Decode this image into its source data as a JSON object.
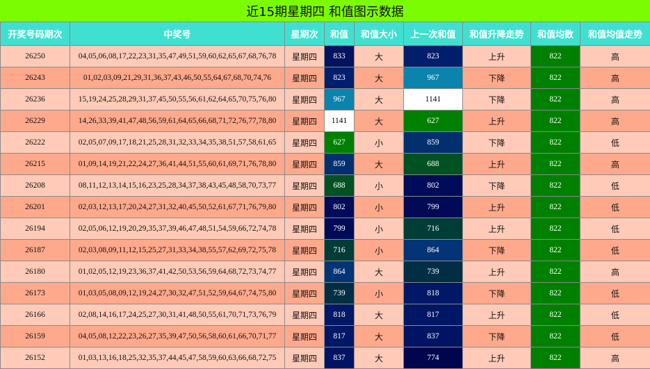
{
  "title": "近15期星期四 和值图示数据",
  "headers": [
    "开奖号码期次",
    "中奖号",
    "星期次",
    "和值",
    "和值大小",
    "上一次和值",
    "和值升降走势",
    "和值均数",
    "和值均值走势"
  ],
  "rows": [
    {
      "period": "26250",
      "numbers": "04,05,06,08,17,22,23,31,35,47,49,51,59,60,62,65,67,68,76,78",
      "weekday": "星期四",
      "sum": "833",
      "size": "大",
      "prev_sum": "823",
      "trend": "上升",
      "avg": "822",
      "avg_trend": "高",
      "sum_color": "#00135e",
      "prev_color": "#001e6b"
    },
    {
      "period": "26243",
      "numbers": "01,02,03,09,21,29,31,36,37,43,46,50,55,64,67,68,70,74,76",
      "weekday": "星期四",
      "sum": "823",
      "size": "大",
      "prev_sum": "967",
      "trend": "下降",
      "avg": "822",
      "avg_trend": "高",
      "sum_color": "#001e6b",
      "prev_color": "#0a83ad"
    },
    {
      "period": "26236",
      "numbers": "15,19,24,25,28,29,31,37,45,50,55,56,61,62,64,65,70,75,76,80",
      "weekday": "星期四",
      "sum": "967",
      "size": "大",
      "prev_sum": "1141",
      "trend": "下降",
      "avg": "822",
      "avg_trend": "高",
      "sum_color": "#0a83ad",
      "prev_color": "#ffffff"
    },
    {
      "period": "26229",
      "numbers": "14,26,33,39,41,47,48,56,59,61,64,65,66,68,71,72,76,77,78,80",
      "weekday": "星期四",
      "sum": "1141",
      "size": "大",
      "prev_sum": "627",
      "trend": "上升",
      "avg": "822",
      "avg_trend": "高",
      "sum_color": "#ffffff",
      "prev_color": "#008000"
    },
    {
      "period": "26222",
      "numbers": "02,05,07,09,17,18,21,25,28,31,32,33,34,35,38,51,57,58,61,65",
      "weekday": "星期四",
      "sum": "627",
      "size": "小",
      "prev_sum": "859",
      "trend": "下降",
      "avg": "822",
      "avg_trend": "低",
      "sum_color": "#008000",
      "prev_color": "#02306f"
    },
    {
      "period": "26215",
      "numbers": "01,09,14,19,21,22,24,27,36,41,44,51,55,60,61,69,71,76,78,80",
      "weekday": "星期四",
      "sum": "859",
      "size": "大",
      "prev_sum": "688",
      "trend": "上升",
      "avg": "822",
      "avg_trend": "高",
      "sum_color": "#02306f",
      "prev_color": "#005222"
    },
    {
      "period": "26208",
      "numbers": "08,11,12,13,14,15,16,23,25,28,34,37,38,43,45,48,58,70,73,77",
      "weekday": "星期四",
      "sum": "688",
      "size": "小",
      "prev_sum": "802",
      "trend": "下降",
      "avg": "822",
      "avg_trend": "低",
      "sum_color": "#005222",
      "prev_color": "#000c5a"
    },
    {
      "period": "26201",
      "numbers": "02,03,12,13,17,20,24,27,31,32,40,45,50,52,61,67,71,76,79,80",
      "weekday": "星期四",
      "sum": "802",
      "size": "小",
      "prev_sum": "799",
      "trend": "上升",
      "avg": "822",
      "avg_trend": "低",
      "sum_color": "#000c5a",
      "prev_color": "#000a57"
    },
    {
      "period": "26194",
      "numbers": "02,05,06,12,19,20,29,35,37,39,46,47,48,51,54,59,66,72,74,78",
      "weekday": "星期四",
      "sum": "799",
      "size": "小",
      "prev_sum": "716",
      "trend": "上升",
      "avg": "822",
      "avg_trend": "低",
      "sum_color": "#000a57",
      "prev_color": "#003d36"
    },
    {
      "period": "26187",
      "numbers": "02,03,08,09,11,12,15,25,27,31,33,34,38,55,57,62,69,72,75,78",
      "weekday": "星期四",
      "sum": "716",
      "size": "小",
      "prev_sum": "864",
      "trend": "下降",
      "avg": "822",
      "avg_trend": "低",
      "sum_color": "#003d36",
      "prev_color": "#033475"
    },
    {
      "period": "26180",
      "numbers": "01,02,05,12,19,23,36,37,41,42,50,53,56,59,64,68,72,73,74,77",
      "weekday": "星期四",
      "sum": "864",
      "size": "大",
      "prev_sum": "739",
      "trend": "上升",
      "avg": "822",
      "avg_trend": "高",
      "sum_color": "#033475",
      "prev_color": "#002e44"
    },
    {
      "period": "26173",
      "numbers": "01,03,05,08,09,12,19,24,27,30,32,47,51,52,59,64,67,74,75,80",
      "weekday": "星期四",
      "sum": "739",
      "size": "小",
      "prev_sum": "818",
      "trend": "下降",
      "avg": "822",
      "avg_trend": "低",
      "sum_color": "#002e44",
      "prev_color": "#001866"
    },
    {
      "period": "26166",
      "numbers": "02,08,14,16,17,24,25,27,30,31,41,48,50,55,61,70,71,73,76,79",
      "weekday": "星期四",
      "sum": "818",
      "size": "大",
      "prev_sum": "817",
      "trend": "上升",
      "avg": "822",
      "avg_trend": "低",
      "sum_color": "#001866",
      "prev_color": "#001765"
    },
    {
      "period": "26159",
      "numbers": "04,05,08,12,22,23,26,27,35,39,47,50,56,58,60,61,66,70,71,77",
      "weekday": "星期四",
      "sum": "817",
      "size": "大",
      "prev_sum": "837",
      "trend": "下降",
      "avg": "822",
      "avg_trend": "低",
      "sum_color": "#001765",
      "prev_color": "#001463"
    },
    {
      "period": "26152",
      "numbers": "01,03,13,16,18,25,32,35,37,44,45,47,58,59,60,63,66,68,72,75",
      "weekday": "星期四",
      "sum": "837",
      "size": "大",
      "prev_sum": "774",
      "trend": "上升",
      "avg": "822",
      "avg_trend": "高",
      "sum_color": "#001463",
      "prev_color": "#00054d"
    }
  ]
}
